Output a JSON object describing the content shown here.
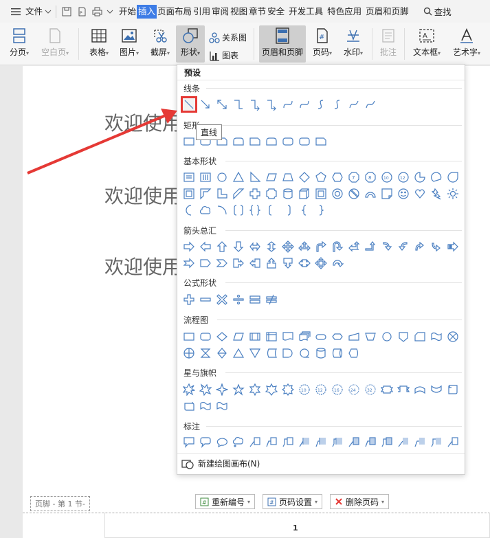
{
  "menubar": {
    "file_label": "文件",
    "tabs": [
      "开始",
      "插入",
      "页面布局",
      "引用",
      "审阅",
      "视图",
      "章节",
      "安全",
      "开发工具",
      "特色应用",
      "页眉和页脚"
    ],
    "active_tab": "插入",
    "search_label": "查找"
  },
  "ribbon": {
    "fenye": "分页",
    "kongbaiye": "空白页",
    "biaoge": "表格",
    "tupian": "图片",
    "jieping": "截屏",
    "xingzhuang": "形状",
    "guanxitu": "关系图",
    "tubiao": "图表",
    "yemeiheyejiao": "页眉和页脚",
    "yema": "页码",
    "shuiyin": "水印",
    "pizhu": "批注",
    "wenbenkuang": "文本框",
    "yishuzi": "艺术字"
  },
  "document": {
    "lines": [
      "欢迎使用",
      "欢迎使用",
      "欢迎使用"
    ],
    "footer_tag": "页脚 - 第 1 节-",
    "renumber": "重新编号",
    "page_settings": "页码设置",
    "delete_page_number": "删除页码",
    "page_number": "1"
  },
  "shapes_panel": {
    "title": "预设",
    "sections": {
      "lines": "线条",
      "rect": "矩形",
      "basic": "基本形状",
      "arrows": "箭头总汇",
      "formula": "公式形状",
      "flowchart": "流程图",
      "stars": "星与旗帜",
      "callouts": "标注"
    },
    "tooltip": "直线",
    "new_canvas": "新建绘图画布(N)"
  },
  "colors": {
    "accent": "#3d7ce6",
    "shape_stroke": "#4a7fc1",
    "highlight": "#e53935"
  }
}
